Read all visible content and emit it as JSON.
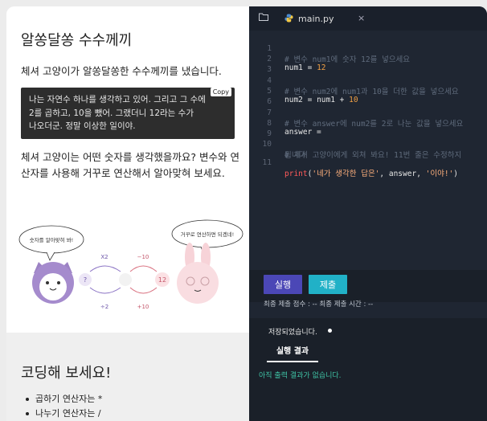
{
  "problem": {
    "title": "알쏭달쏭 수수께끼",
    "description": "체셔 고양이가 알쏭달쏭한 수수께끼를 냈습니다.",
    "quote_lines": [
      "나는 자연수 하나를 생각하고 있어. 그리고 그 수에",
      "2를 곱하고, 10을 뺐어. 그랬더니 12라는 수가",
      "나오더군. 정말 이상한 일이야."
    ],
    "copy_label": "Copy",
    "question": "체셔 고양이는 어떤 숫자를 생각했을까요? 변수와 연산자를 사용해 거꾸로 연산해서 알아맞혀 보세요.",
    "illustration": {
      "cat_bubble": "숫자를 알아맞혀 봐!",
      "rabbit_bubble": "거꾸로 연산하면 되겠네!",
      "unknown": "?",
      "result": "12",
      "op_times": "X2",
      "op_minus": "−10",
      "op_divide": "÷2",
      "op_plus": "+10"
    },
    "hints_title": "코딩해 보세요!",
    "hints": [
      "곱하기 연산자는 *",
      "나누기 연산자는 /"
    ]
  },
  "editor": {
    "filename": "main.py",
    "lines": [
      {
        "n": "1",
        "kind": "comment",
        "text": "# 변수 num1에 숫자 12를 넣으세요"
      },
      {
        "n": "2",
        "kind": "assign1"
      },
      {
        "n": "3",
        "kind": "blank"
      },
      {
        "n": "4",
        "kind": "comment",
        "text": "# 변수 num2에 num1과 10을 더한 값을 넣으세요"
      },
      {
        "n": "5",
        "kind": "assign2"
      },
      {
        "n": "6",
        "kind": "blank"
      },
      {
        "n": "7",
        "kind": "comment",
        "text": "# 변수 answer에 num2를 2로 나눈 값을 넣으세요"
      },
      {
        "n": "8",
        "kind": "assign3"
      },
      {
        "n": "9",
        "kind": "blank"
      },
      {
        "n": "10",
        "kind": "comment",
        "text": "# 체셔 고양이에게 외쳐 봐요! 11번 줄은 수정하지"
      },
      {
        "n": "",
        "kind": "comment",
        "text": "됩니다"
      },
      {
        "n": "11",
        "kind": "print"
      }
    ],
    "tokens": {
      "num1": "num1",
      "num2": "num2",
      "answer": "answer",
      "val12": "12",
      "val10": "10",
      "print": "print",
      "str1": "'네가 생각한 답은'",
      "str2": "'이야!'"
    }
  },
  "controls": {
    "run_label": "실행",
    "submit_label": "제출",
    "submit_info": "최종 제출 점수 : -- 최종 제출 시간 : --",
    "saved_label": "저장되었습니다.",
    "result_tab": "실행 결과",
    "no_output": "아직 출력 결과가 없습니다."
  },
  "colors": {
    "editor_bg": "#1f2632",
    "run_button": "#4b47b6",
    "submit_button": "#21b1c7",
    "output_text": "#3fc3a5"
  }
}
